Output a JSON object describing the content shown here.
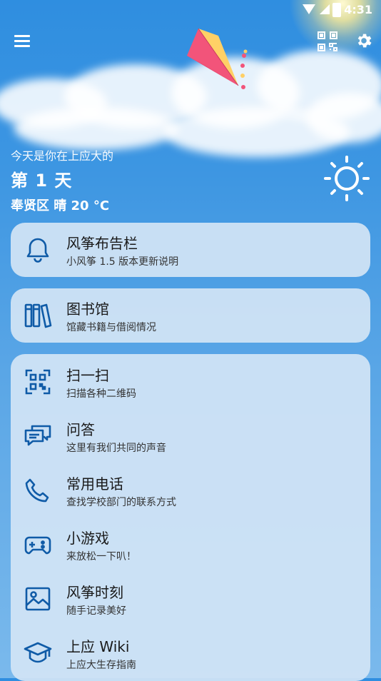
{
  "status_bar": {
    "time": "4:31"
  },
  "greeting": {
    "line1": "今天是你在上应大的",
    "day_count": "第 1 天",
    "weather": "奉贤区 晴 20 °C"
  },
  "notice_card": {
    "title": "风筝布告栏",
    "subtitle": "小风筝 1.5 版本更新说明"
  },
  "library_card": {
    "title": "图书馆",
    "subtitle": "馆藏书籍与借阅情况"
  },
  "menu_items": [
    {
      "title": "扫一扫",
      "subtitle": "扫描各种二维码",
      "icon": "qr-scan-icon"
    },
    {
      "title": "问答",
      "subtitle": "这里有我们共同的声音",
      "icon": "chat-bubbles-icon"
    },
    {
      "title": "常用电话",
      "subtitle": "查找学校部门的联系方式",
      "icon": "phone-icon"
    },
    {
      "title": "小游戏",
      "subtitle": "来放松一下叭！",
      "icon": "gamepad-icon"
    },
    {
      "title": "风筝时刻",
      "subtitle": "随手记录美好",
      "icon": "image-icon"
    },
    {
      "title": "上应 Wiki",
      "subtitle": "上应大生存指南",
      "icon": "graduation-cap-icon"
    }
  ],
  "colors": {
    "accent": "#0f5ba7",
    "sky": "#3d96e2",
    "card": "#d2e4f5"
  }
}
